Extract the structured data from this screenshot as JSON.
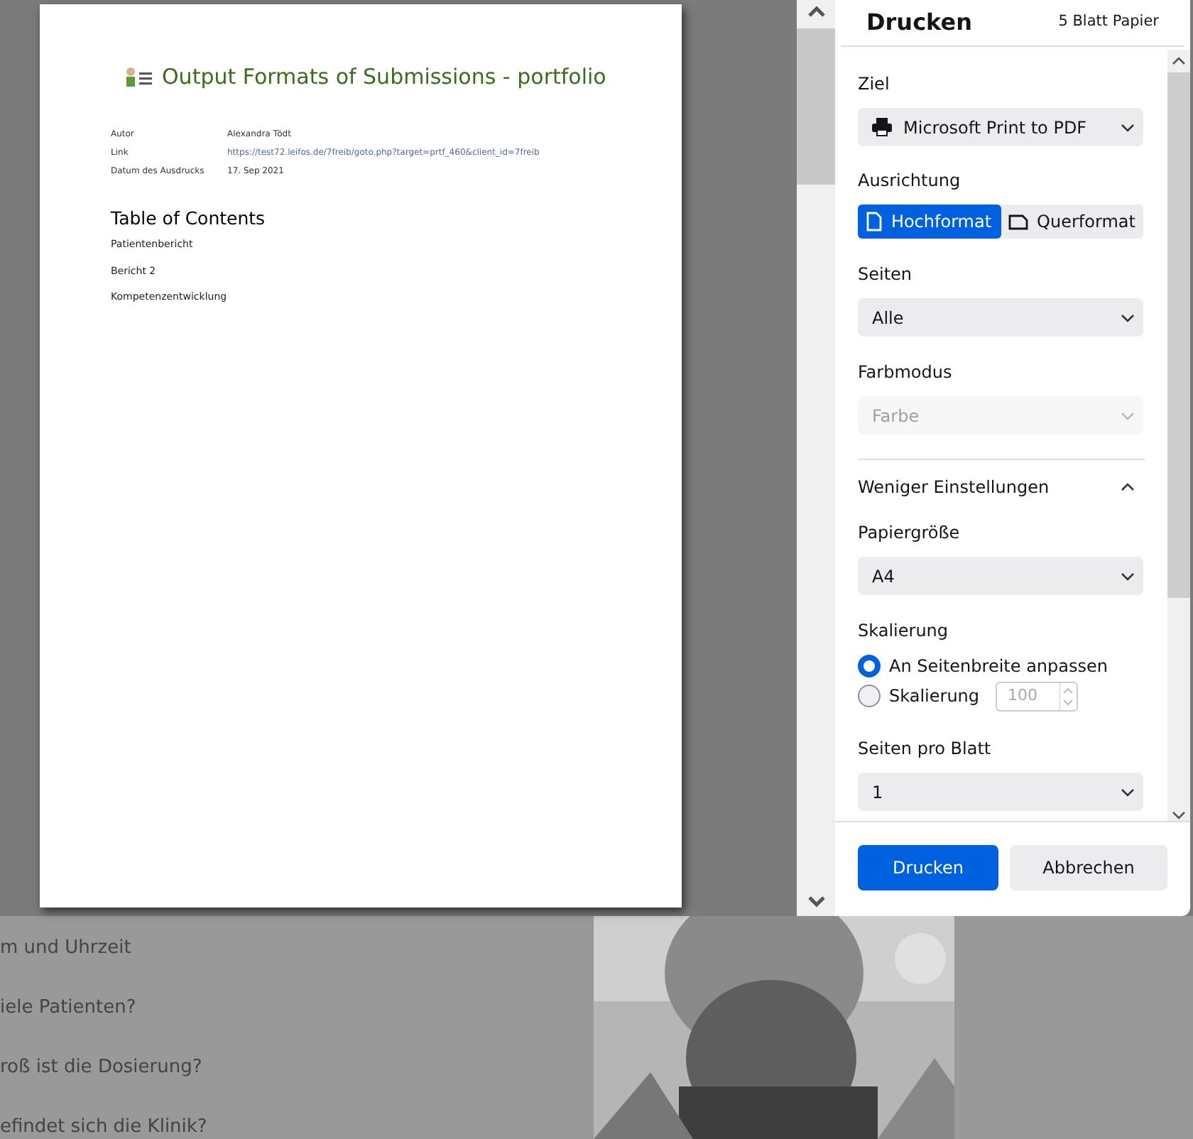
{
  "background_page": {
    "lines": [
      "m und Uhrzeit",
      "iele Patienten?",
      "roß ist die Dosierung?",
      "efindet sich die Klinik?"
    ]
  },
  "preview": {
    "title": "Output Formats of Submissions - portfolio",
    "meta": [
      {
        "label": "Autor",
        "value": "Alexandra Tödt",
        "kind": "text"
      },
      {
        "label": "Link",
        "value": "https://test72.leifos.de/7freib/goto.php?target=prtf_460&client_id=7freib",
        "kind": "link"
      },
      {
        "label": "Datum des Ausdrucks",
        "value": "17. Sep 2021",
        "kind": "text"
      }
    ],
    "toc_heading": "Table of Contents",
    "toc": [
      "Patientenbericht",
      "Bericht 2",
      "Kompetenzentwicklung"
    ]
  },
  "dialog": {
    "title": "Drucken",
    "sheet_count": "5 Blatt Papier",
    "destination": {
      "label": "Ziel",
      "value": "Microsoft Print to PDF"
    },
    "orientation": {
      "label": "Ausrichtung",
      "options": [
        {
          "label": "Hochformat",
          "selected": true,
          "kind": "portrait"
        },
        {
          "label": "Querformat",
          "selected": false,
          "kind": "landscape"
        }
      ]
    },
    "pages": {
      "label": "Seiten",
      "value": "Alle",
      "disabled": false
    },
    "color_mode": {
      "label": "Farbmodus",
      "value": "Farbe",
      "disabled": true
    },
    "more_toggle": {
      "label": "Weniger Einstellungen",
      "expanded": true
    },
    "paper_size": {
      "label": "Papiergröße",
      "value": "A4",
      "disabled": false
    },
    "scaling": {
      "label": "Skalierung",
      "options": [
        {
          "label": "An Seitenbreite anpassen",
          "selected": true
        },
        {
          "label": "Skalierung",
          "selected": false
        }
      ],
      "field": {
        "value": "100",
        "disabled": true
      }
    },
    "pages_per_sheet": {
      "label": "Seiten pro Blatt",
      "value": "1",
      "disabled": false
    },
    "buttons": [
      {
        "label": "Drucken",
        "kind": "primary"
      },
      {
        "label": "Abbrechen",
        "kind": "secondary"
      }
    ]
  }
}
